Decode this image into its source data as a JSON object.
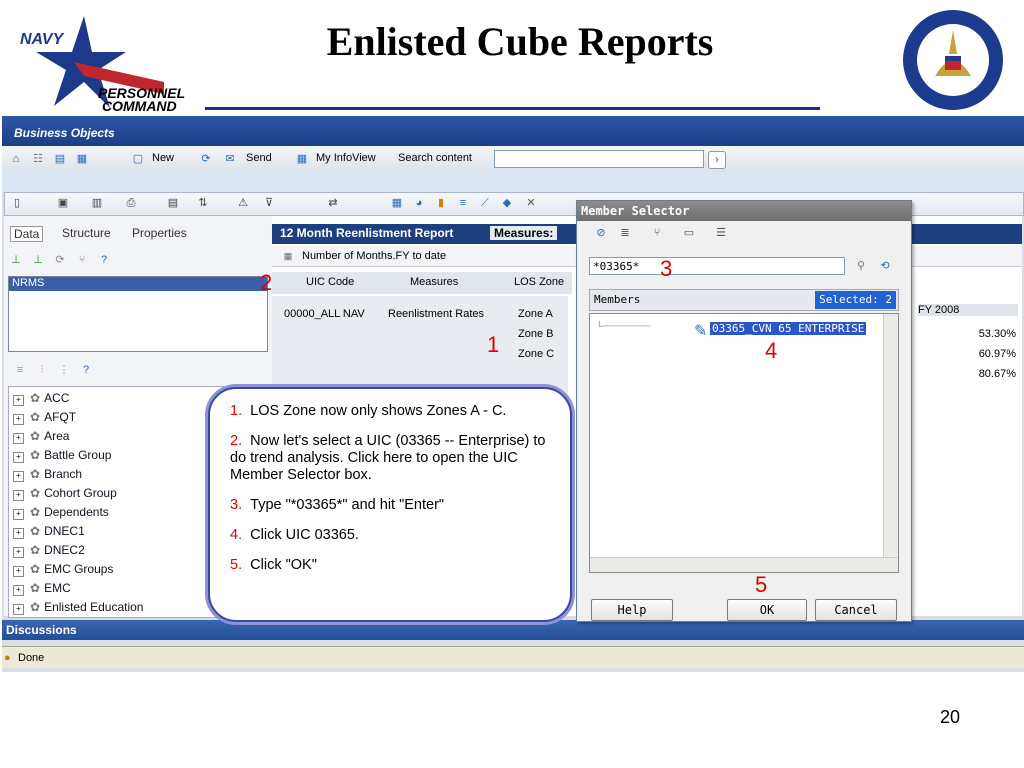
{
  "slide": {
    "title": "Enlisted Cube Reports",
    "page_number": "20",
    "logo_text": {
      "navy": "NAVY",
      "personnel": "PERSONNEL",
      "command": "COMMAND"
    }
  },
  "app": {
    "brand": "Business Objects",
    "toolbar": {
      "new_label": "New",
      "send_label": "Send",
      "my_infoview_label": "My InfoView",
      "search_content_label": "Search content",
      "search_value": ""
    },
    "left_panel": {
      "tabs": [
        "Data",
        "Structure",
        "Properties"
      ],
      "selected_cube": "NRMS",
      "tree_items": [
        "ACC",
        "AFQT",
        "Area",
        "Battle Group",
        "Branch",
        "Cohort Group",
        "Dependents",
        "DNEC1",
        "DNEC2",
        "EMC Groups",
        "EMC",
        "Enlisted Education"
      ]
    },
    "report": {
      "title": "12 Month Reenlistment Report",
      "measures_tab": "Measures:",
      "number_row": "Number of Months.FY to date",
      "axis_chips": [
        "UIC Code",
        "Measures",
        "LOS Zone"
      ],
      "row_uic": "00000_ALL NAV",
      "row_measure": "Reenlistment Rates",
      "zones": [
        "Zone A",
        "Zone B",
        "Zone C"
      ],
      "fy_header": "FY 2008",
      "fy_values": [
        "53.30%",
        "60.97%",
        "80.67%"
      ]
    },
    "discussions_label": "Discussions",
    "status_text": "Done"
  },
  "member_selector": {
    "title": "Member Selector",
    "search_value": "*03365*",
    "members_label": "Members",
    "selected_label": "Selected: 2",
    "member_item": "03365_CVN 65 ENTERPRISE",
    "buttons": {
      "help": "Help",
      "ok": "OK",
      "cancel": "Cancel"
    }
  },
  "callout": {
    "steps": [
      {
        "n": "1.",
        "text": "LOS Zone now only shows Zones A - C."
      },
      {
        "n": "2.",
        "text": "Now let's select a UIC (03365 -- Enterprise) to do trend analysis.  Click here to open the UIC Member Selector box."
      },
      {
        "n": "3.",
        "text": "Type \"*03365*\" and hit \"Enter\""
      },
      {
        "n": "4.",
        "text": "Click UIC 03365."
      },
      {
        "n": "5.",
        "text": "Click \"OK\""
      }
    ]
  },
  "step_markers": [
    "1",
    "2",
    "3",
    "4",
    "5"
  ],
  "colors": {
    "accent_red": "#e00000",
    "navy_blue": "#1b2a8c",
    "selection_blue": "#2a56c6"
  }
}
